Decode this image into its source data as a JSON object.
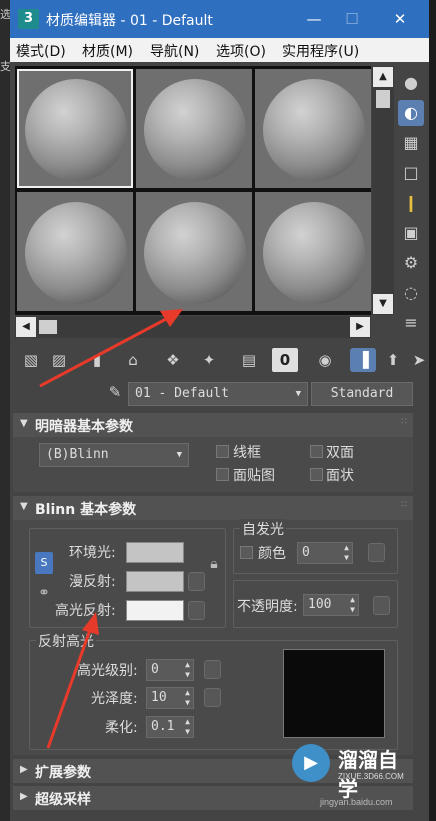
{
  "window": {
    "app_icon": "3",
    "title": "材质编辑器 - 01 - Default",
    "minimize_icon": "minimize-icon",
    "maximize_icon": "maximize-icon",
    "close_icon": "close-icon"
  },
  "left_edge": {
    "char1": "选",
    "char2": "支"
  },
  "menu": [
    {
      "label": "模式(D)"
    },
    {
      "label": "材质(M)"
    },
    {
      "label": "导航(N)"
    },
    {
      "label": "选项(O)"
    },
    {
      "label": "实用程序(U)"
    }
  ],
  "material_name": "01 - Default",
  "material_type": "Standard",
  "shader_rollout": {
    "title": "明暗器基本参数",
    "shader": "(B)Blinn",
    "wire": "线框",
    "two_sided": "双面",
    "face_map": "面贴图",
    "faceted": "面状"
  },
  "blinn_rollout": {
    "title": "Blinn 基本参数",
    "self_illum_group": "自发光",
    "self_illum_color": "颜色",
    "self_illum_value": "0",
    "ambient": "环境光:",
    "diffuse": "漫反射:",
    "specular": "高光反射:",
    "opacity_label": "不透明度:",
    "opacity_value": "100",
    "spec_highlights_group": "反射高光",
    "spec_level_label": "高光级别:",
    "spec_level_value": "0",
    "glossiness_label": "光泽度:",
    "glossiness_value": "10",
    "soften_label": "柔化:",
    "soften_value": "0.1"
  },
  "extended_rollout": {
    "title": "扩展参数"
  },
  "supersampling_rollout": {
    "title": "超级采样"
  },
  "watermark": {
    "logo": "▶",
    "text": "溜溜自学",
    "url": "ZIXUE.3D66.COM",
    "baidu": "jingyan.baidu.com"
  },
  "colors": {
    "titlebar": "#2e6fc0",
    "ambient_swatch": "#c4c4c4",
    "diffuse_swatch": "#c4c4c4",
    "specular_swatch": "#f2f2f2",
    "highlight_preview": "#0a0a0a",
    "annotation_arrow": "#e83a2a"
  }
}
